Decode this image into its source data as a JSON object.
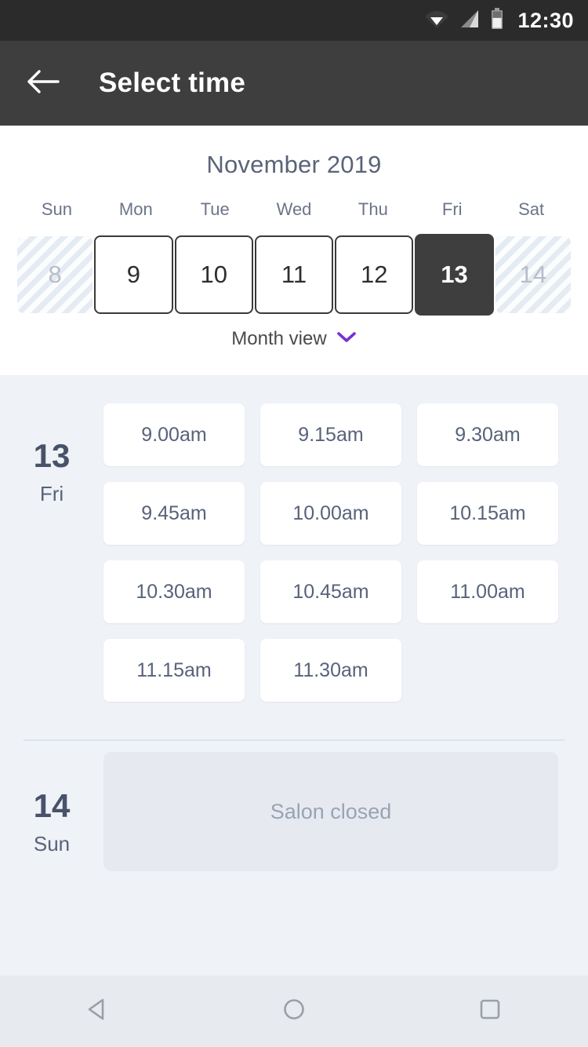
{
  "status_bar": {
    "time": "12:30",
    "icons": [
      "wifi-icon",
      "cellular-signal-icon",
      "battery-icon"
    ]
  },
  "app_bar": {
    "back_icon": "back-arrow-icon",
    "title": "Select time"
  },
  "calendar": {
    "month_title": "November 2019",
    "weekdays": [
      "Sun",
      "Mon",
      "Tue",
      "Wed",
      "Thu",
      "Fri",
      "Sat"
    ],
    "dates": [
      {
        "day": "8",
        "state": "disabled"
      },
      {
        "day": "9",
        "state": "enabled"
      },
      {
        "day": "10",
        "state": "enabled"
      },
      {
        "day": "11",
        "state": "enabled"
      },
      {
        "day": "12",
        "state": "enabled"
      },
      {
        "day": "13",
        "state": "selected"
      },
      {
        "day": "14",
        "state": "disabled"
      }
    ],
    "view_toggle": {
      "label": "Month view",
      "chevron_icon": "chevron-down-icon",
      "chevron_color": "#7B2FD4"
    }
  },
  "schedule": {
    "days": [
      {
        "day_number": "13",
        "day_of_week": "Fri",
        "slots": [
          "9.00am",
          "9.15am",
          "9.30am",
          "9.45am",
          "10.00am",
          "10.15am",
          "10.30am",
          "10.45am",
          "11.00am",
          "11.15am",
          "11.30am"
        ]
      },
      {
        "day_number": "14",
        "day_of_week": "Sun",
        "closed_message": "Salon closed"
      }
    ]
  },
  "nav_bar": {
    "back": "nav-back-icon",
    "home": "nav-home-icon",
    "recents": "nav-recents-icon"
  },
  "colors": {
    "app_bar_bg": "#3E3E3E",
    "status_bar_bg": "#2B2B2B",
    "page_bg": "#EFF2F6",
    "accent_purple": "#7B2FD4",
    "selected_day_bg": "#3E3E3E",
    "text_slate": "#58627A"
  }
}
